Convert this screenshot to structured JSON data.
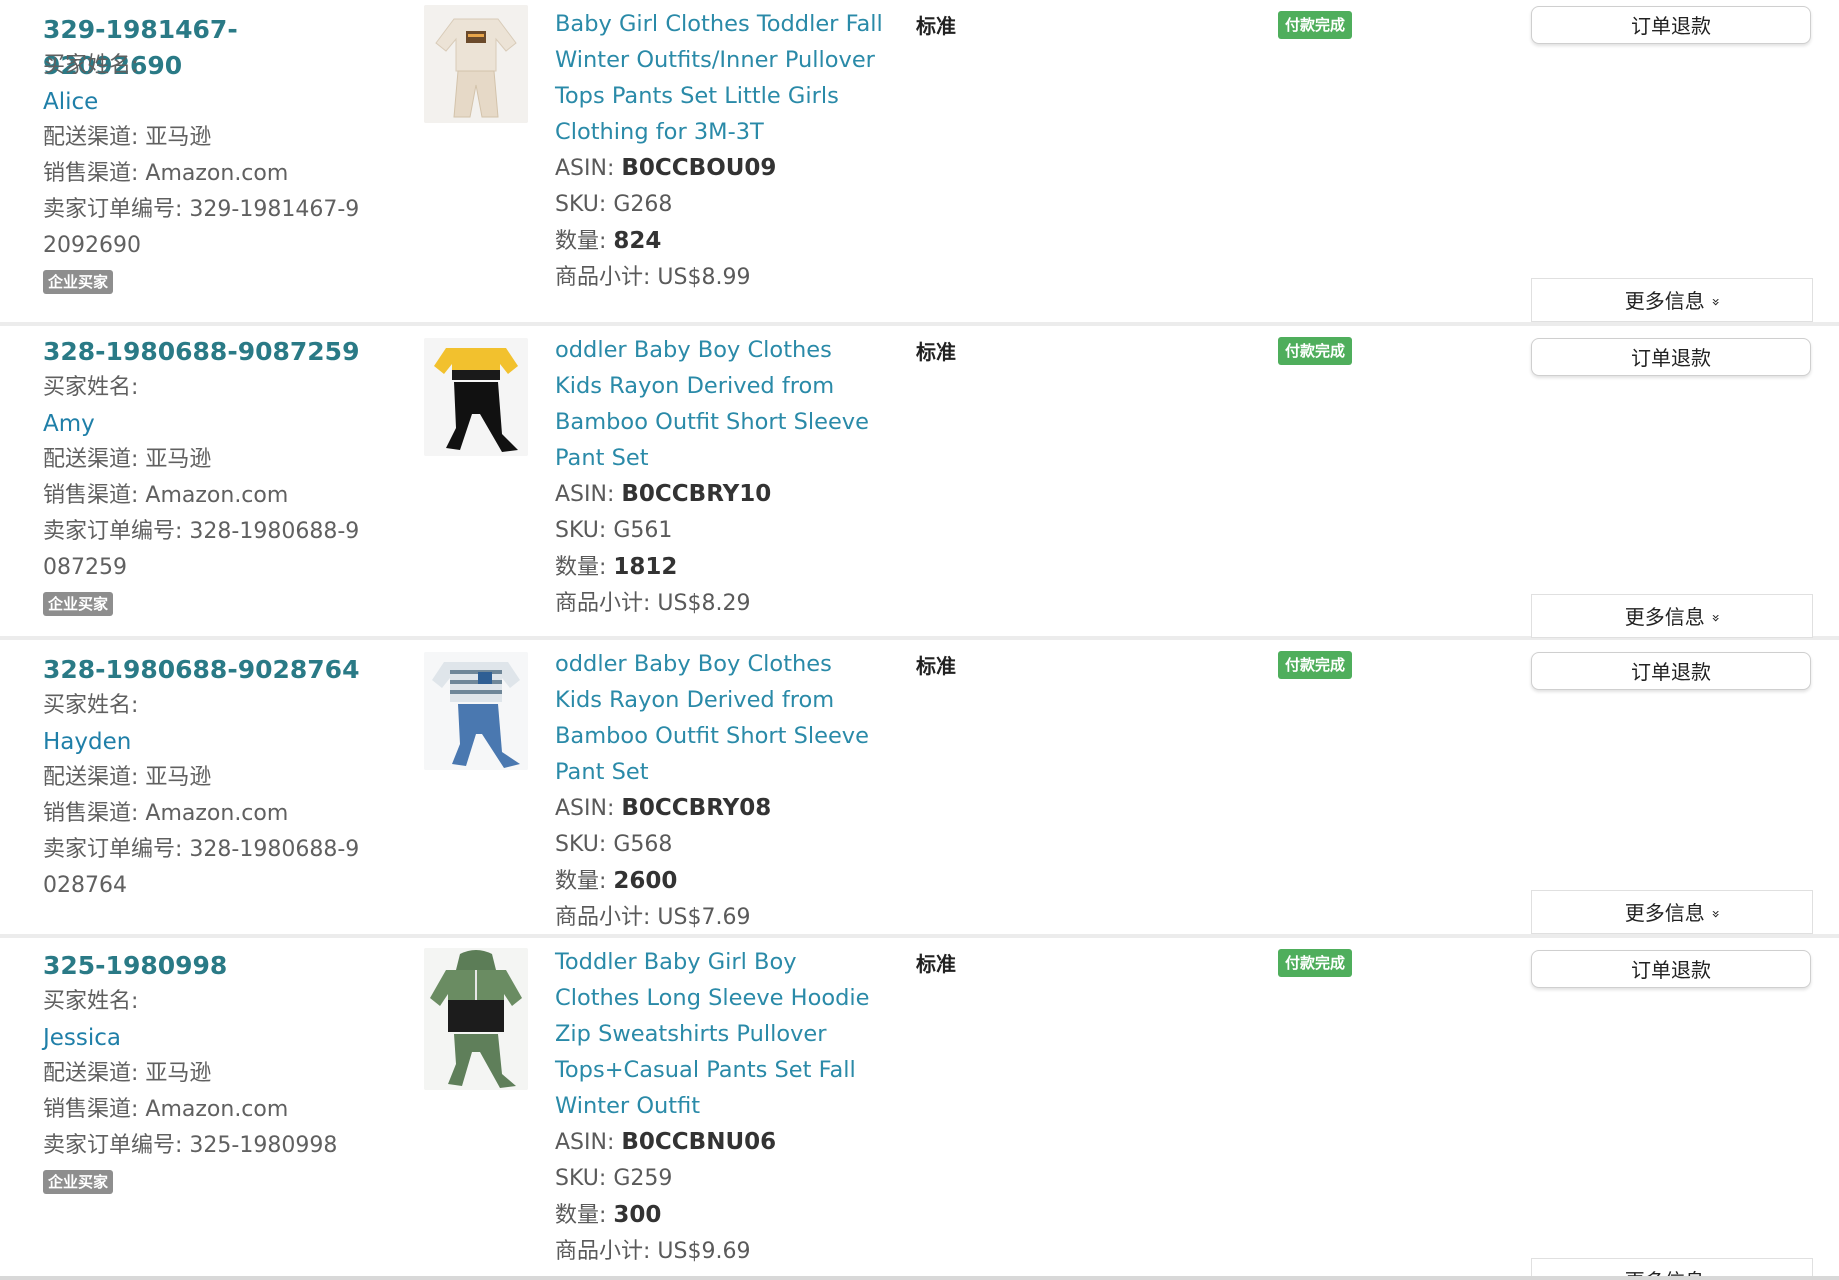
{
  "common": {
    "buyer_name_label": "买家姓名:",
    "ship_channel": "配送渠道: 亚马逊",
    "sales_channel": "销售渠道: Amazon.com",
    "business_buyer_badge": "企业买家",
    "asin_label": "ASIN:",
    "sku_label": "SKU:",
    "qty_label": "数量:",
    "subtotal_label": "商品小计:",
    "shipping_type": "标准",
    "payment_status": "付款完成",
    "refund_button": "订单退款",
    "more_info_button": "更多信息",
    "more_info_chevron": "»"
  },
  "orders": [
    {
      "order_id": "329-1981467-92092690",
      "buyer_name": "Alice",
      "seller_order_no": "卖家订单编号: 329-1981467-92092690",
      "has_business_badge": true,
      "product_title": "Baby Girl Clothes Toddler Fall Winter Outfits/Inner Pullover Tops Pants Set Little Girls Clothing for 3M-3T",
      "asin": "B0CCBOU09",
      "sku": "G268",
      "quantity": "824",
      "subtotal": "US$8.99",
      "thumb_icon": "beige-sweatsuit-product-image"
    },
    {
      "order_id": "328-1980688-9087259",
      "buyer_name": "Amy",
      "seller_order_no": "卖家订单编号: 328-1980688-9087259",
      "has_business_badge": true,
      "product_title": "oddler Baby Boy Clothes Kids Rayon Derived from Bamboo Outfit Short Sleeve Pant Set",
      "asin": "B0CCBRY10",
      "sku": "G561",
      "quantity": "1812",
      "subtotal": "US$8.29",
      "thumb_icon": "yellow-black-outfit-product-image"
    },
    {
      "order_id": "328-1980688-9028764",
      "buyer_name": "Hayden",
      "seller_order_no": "卖家订单编号: 328-1980688-9028764",
      "has_business_badge": false,
      "product_title": "oddler Baby Boy Clothes Kids Rayon Derived from Bamboo Outfit Short Sleeve Pant Set",
      "asin": "B0CCBRY08",
      "sku": "G568",
      "quantity": "2600",
      "subtotal": "US$7.69",
      "thumb_icon": "striped-shirt-jeans-product-image"
    },
    {
      "order_id": "325-1980998",
      "buyer_name": "Jessica",
      "seller_order_no": "卖家订单编号: 325-1980998",
      "has_business_badge": true,
      "product_title": "Toddler Baby Girl Boy Clothes Long Sleeve Hoodie Zip Sweatshirts Pullover Tops+Casual Pants Set Fall Winter Outfit",
      "asin": "B0CCBNU06",
      "sku": "G259",
      "quantity": "300",
      "subtotal": "US$9.69",
      "thumb_icon": "green-hoodie-set-product-image"
    }
  ]
}
